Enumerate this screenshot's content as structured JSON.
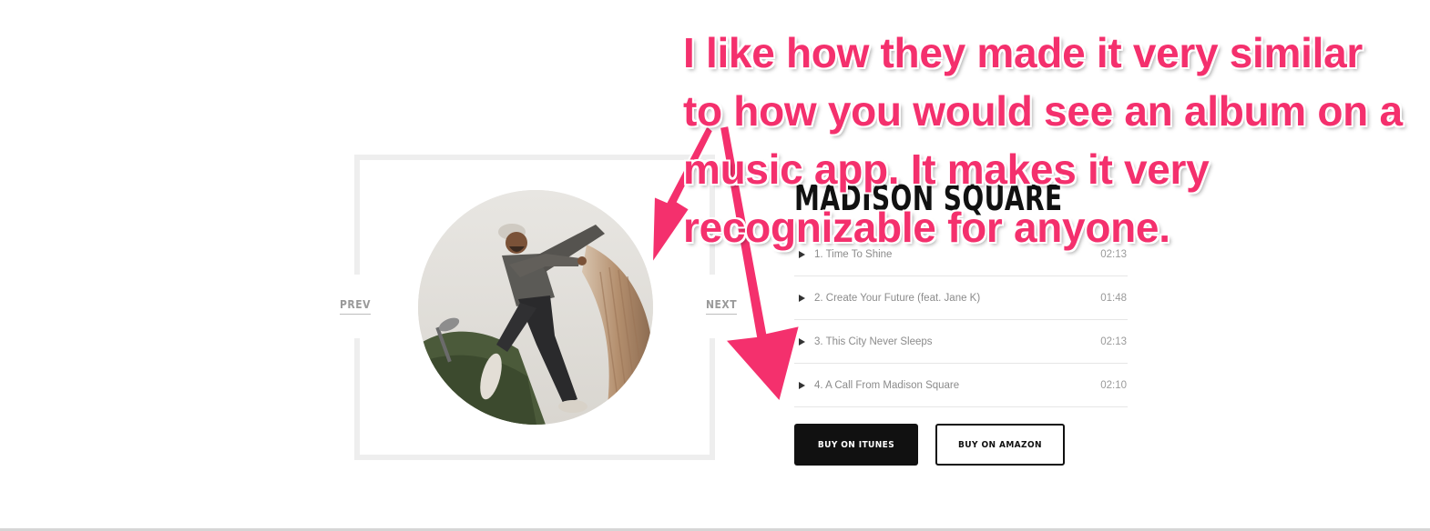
{
  "album": {
    "title": "MADISON SQUARE",
    "nav_prev": "PREV",
    "nav_next": "NEXT",
    "cover_icon": "album-cover-photo"
  },
  "tracks": [
    {
      "name": "1. Time To Shine",
      "duration": "02:13"
    },
    {
      "name": "2. Create Your Future (feat. Jane K)",
      "duration": "01:48"
    },
    {
      "name": "3. This City Never Sleeps",
      "duration": "02:13"
    },
    {
      "name": "4. A Call From Madison Square",
      "duration": "02:10"
    }
  ],
  "buttons": {
    "itunes": "BUY ON ITUNES",
    "amazon": "BUY ON AMAZON"
  },
  "annotation": {
    "text": "I like how they made it very similar to how you would see an album on a music app. It makes it very recognizable for anyone.",
    "color": "#f4306d"
  },
  "colors": {
    "button_dark": "#111111",
    "frame": "#eeeeee"
  }
}
